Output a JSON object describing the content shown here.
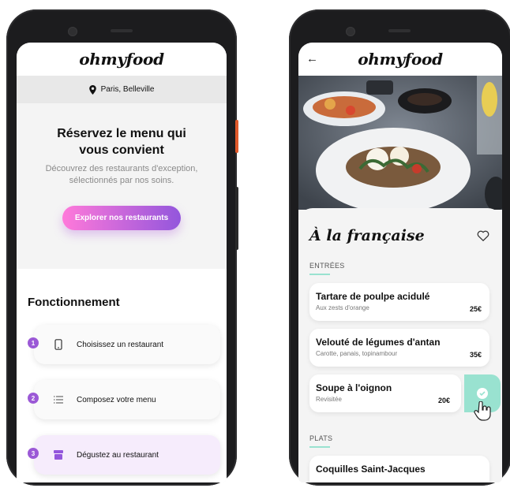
{
  "left": {
    "brand": "ohmyfood",
    "location": "Paris, Belleville",
    "hero": {
      "title_line1": "Réservez le menu qui",
      "title_line2": "vous convient",
      "subtitle_line1": "Découvrez des restaurants d'exception,",
      "subtitle_line2": "sélectionnés par nos soins.",
      "cta": "Explorer nos restaurants"
    },
    "how": {
      "title": "Fonctionnement",
      "steps": [
        {
          "num": "1",
          "label": "Choisissez un restaurant",
          "icon": "phone-icon"
        },
        {
          "num": "2",
          "label": "Composez votre menu",
          "icon": "list-icon"
        },
        {
          "num": "3",
          "label": "Dégustez au restaurant",
          "icon": "store-icon"
        }
      ]
    }
  },
  "right": {
    "brand": "ohmyfood",
    "back": "←",
    "restaurant_title": "À la française",
    "sections": {
      "entrees": "ENTRÉES",
      "plats": "PLATS"
    },
    "dishes": [
      {
        "name": "Tartare de poulpe acidulé",
        "desc": "Aux zests d'orange",
        "price": "25€"
      },
      {
        "name": "Velouté de légumes d'antan",
        "desc": "Carotte, panais, topinambour",
        "price": "35€"
      },
      {
        "name": "Soupe à l'oignon",
        "desc": "Revisitée",
        "price": "20€"
      },
      {
        "name": "Coquilles Saint-Jacques",
        "desc": "",
        "price": ""
      }
    ]
  },
  "colors": {
    "primary_purple": "#9356dc",
    "primary_pink": "#ff79da",
    "mint": "#99e2d0"
  }
}
